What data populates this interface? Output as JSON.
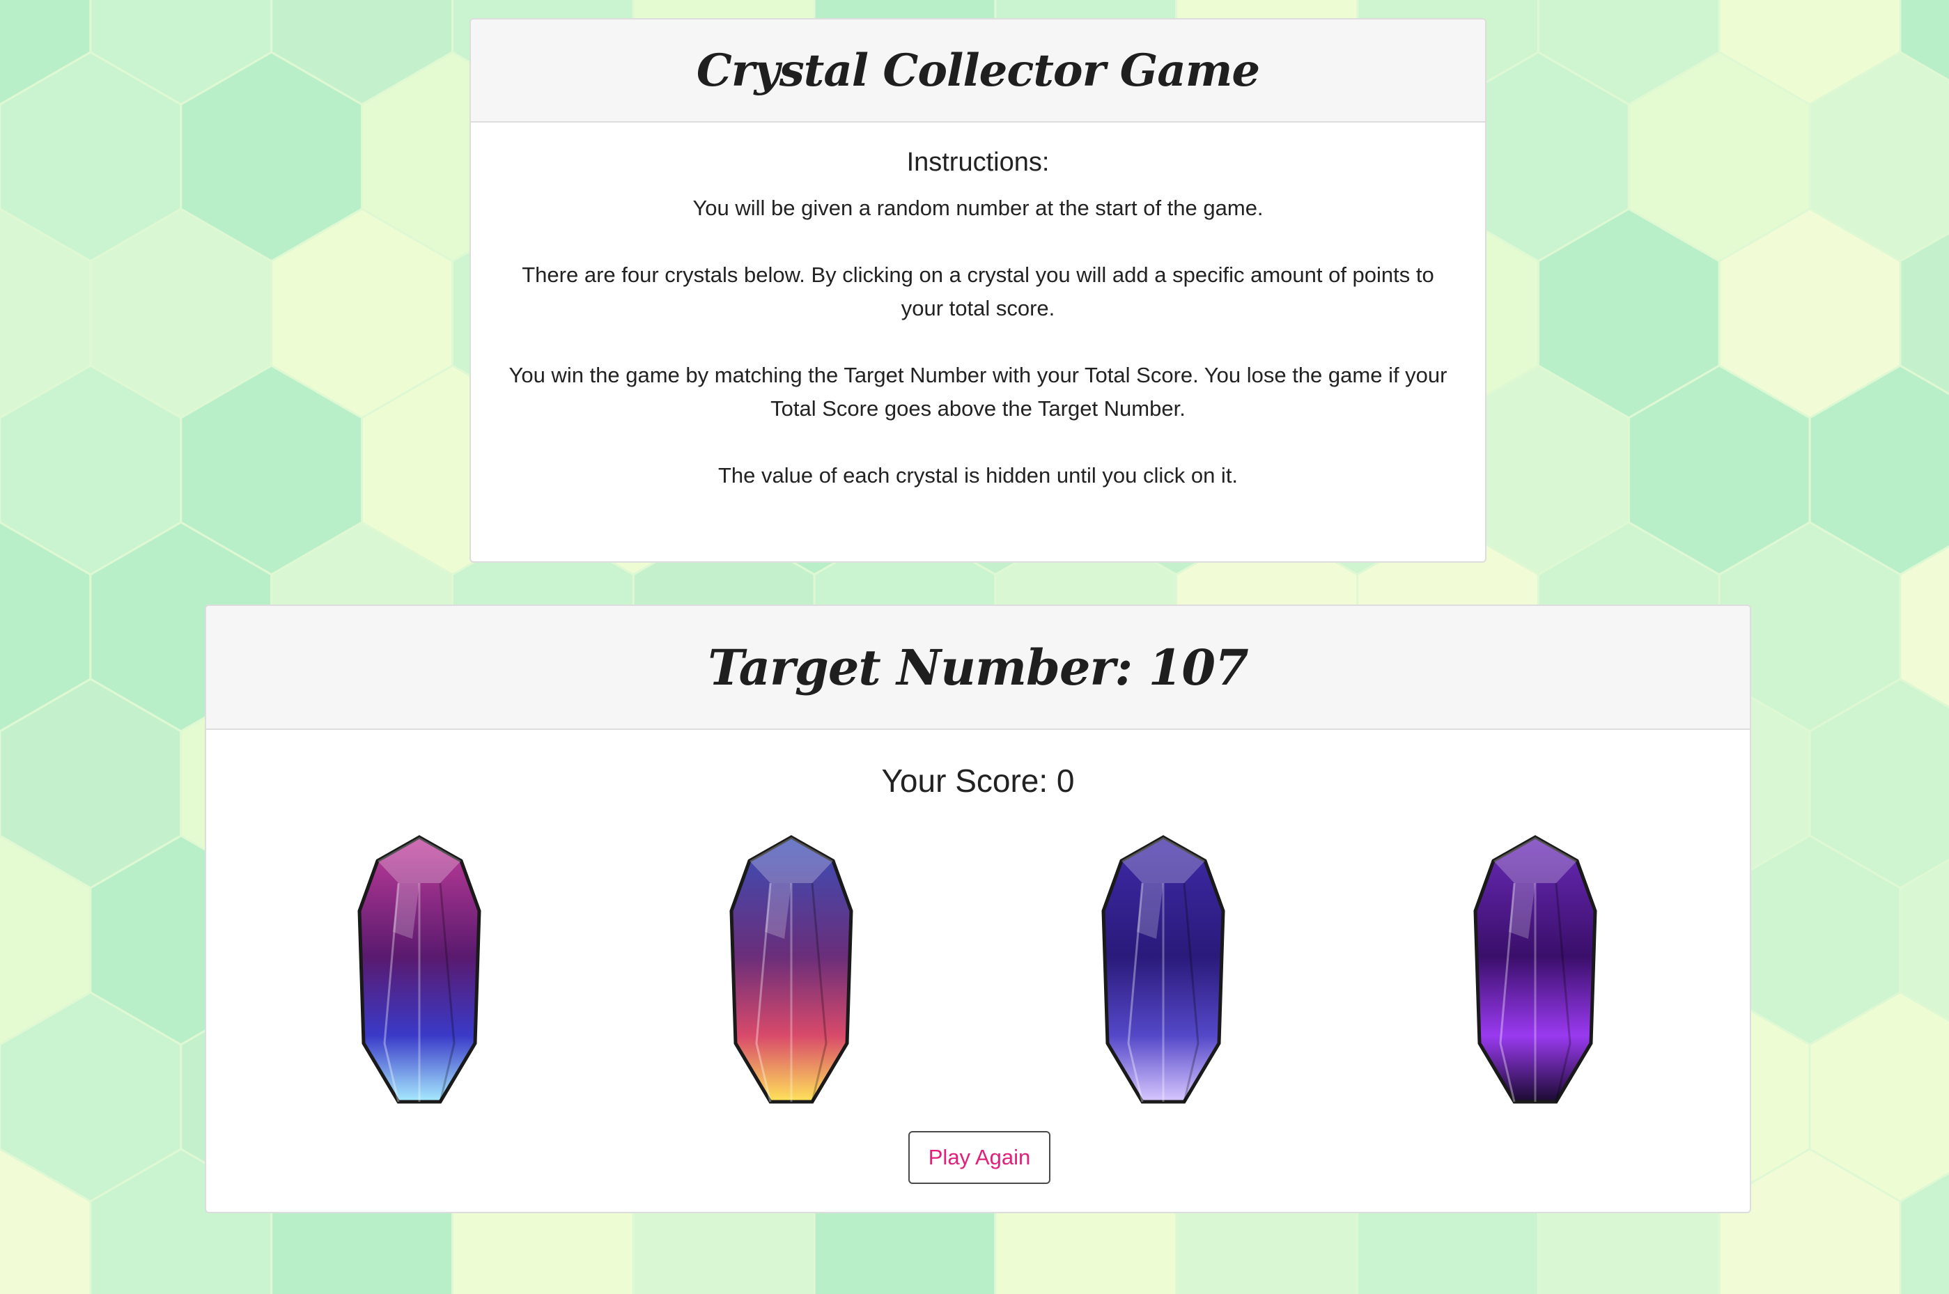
{
  "instructions": {
    "title": "Crystal Collector Game",
    "heading": "Instructions:",
    "paragraphs": [
      "You will be given a random number at the start of the game.",
      "There are four crystals below. By clicking on a crystal you will add a specific amount of points to your total score.",
      "You win the game by matching the Target Number with your Total Score. You lose the game if your Total Score goes above the Target Number.",
      "The value of each crystal is hidden until you click on it."
    ]
  },
  "game": {
    "target_label": "Target Number: ",
    "target_value": "107",
    "score_label": "Your Score: ",
    "score_value": "0",
    "crystals": [
      {
        "name": "crystal-1",
        "colors": [
          "#c23d9b",
          "#5a1a6e",
          "#3a3ac8",
          "#a8ecff"
        ]
      },
      {
        "name": "crystal-2",
        "colors": [
          "#3b4fb8",
          "#6a2e7a",
          "#d84a6a",
          "#ffe45a"
        ]
      },
      {
        "name": "crystal-3",
        "colors": [
          "#3f2aa8",
          "#2a1a7a",
          "#5548c8",
          "#d8c8ff"
        ]
      },
      {
        "name": "crystal-4",
        "colors": [
          "#6a2ab8",
          "#3a0f6a",
          "#9a3af0",
          "#1a0a30"
        ]
      }
    ],
    "play_again_label": "Play Again"
  },
  "colors": {
    "background_light": "#eefcd4",
    "background_mid": "#c9f4cf",
    "accent_pink": "#e0207a",
    "heading_bg": "#f6f6f6"
  }
}
